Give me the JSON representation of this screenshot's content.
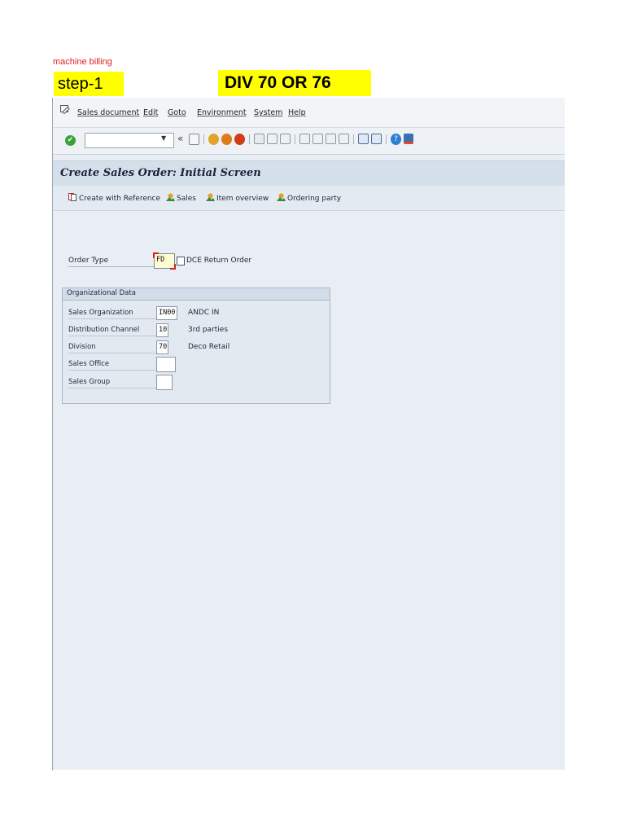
{
  "annotations": {
    "note": "machine billing",
    "step": "step-1",
    "division_note": "DIV 70 OR 76"
  },
  "menu": {
    "items": [
      "Sales document",
      "Edit",
      "Goto",
      "Environment",
      "System",
      "Help"
    ]
  },
  "toolbar": {
    "command_field": "",
    "icons": [
      "check-icon",
      "save-icon",
      "back-icon",
      "exit-icon",
      "cancel-icon",
      "print-icon",
      "find-icon",
      "find-next-icon",
      "first-page-icon",
      "previous-page-icon",
      "next-page-icon",
      "last-page-icon",
      "create-session-icon",
      "shortcut-icon",
      "help-icon",
      "customize-layout-icon"
    ],
    "colors": {
      "ok": "#39a13a",
      "back": "#e0a52a",
      "exit": "#e07b1a",
      "cancel": "#d23a1a"
    }
  },
  "title": "Create Sales Order: Initial Screen",
  "app_toolbar": {
    "create_with_reference": "Create with Reference",
    "sales": "Sales",
    "item_overview": "Item overview",
    "ordering_party": "Ordering party"
  },
  "order_type": {
    "label": "Order Type",
    "value": "FD",
    "description": "DCE Return Order"
  },
  "org_data": {
    "title": "Organizational Data",
    "rows": [
      {
        "label": "Sales Organization",
        "value": "IN00",
        "description": "ANDC IN"
      },
      {
        "label": "Distribution Channel",
        "value": "10",
        "description": "3rd parties"
      },
      {
        "label": "Division",
        "value": "70",
        "description": "Deco Retail"
      },
      {
        "label": "Sales Office",
        "value": "",
        "description": ""
      },
      {
        "label": "Sales Group",
        "value": "",
        "description": ""
      }
    ]
  }
}
